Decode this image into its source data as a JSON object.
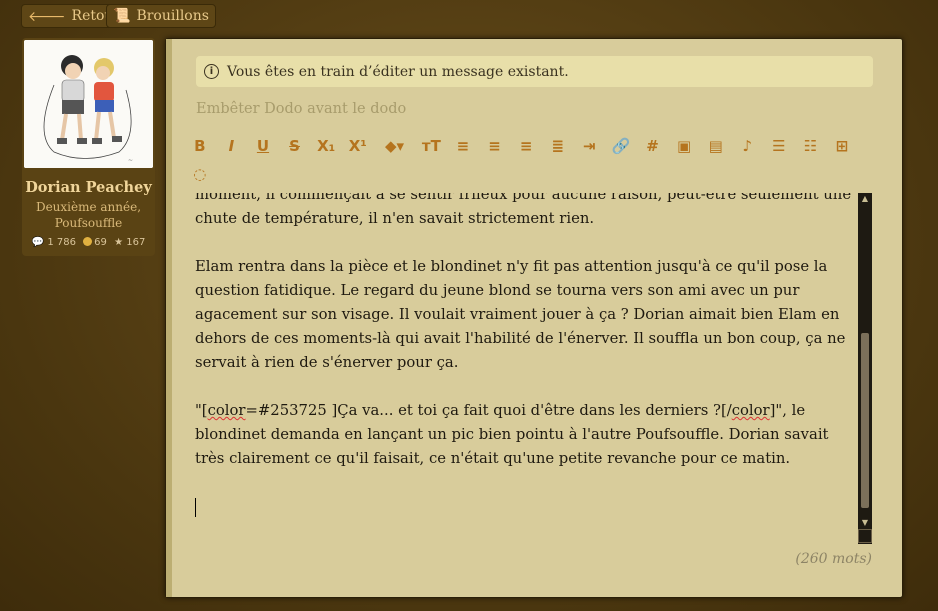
{
  "topbar": {
    "back_label": "Retour",
    "drafts_label": "Brouillons",
    "back_icon": "arrow-left-icon",
    "drafts_icon": "scroll-icon"
  },
  "profile": {
    "name": "Dorian Peachey",
    "rank": "Deuxième année, Poufsouffle",
    "stats": {
      "messages": "1 786",
      "points": "69",
      "reputation": "167"
    }
  },
  "editor": {
    "notice": "Vous êtes en train d’éditer un message existant.",
    "subject": "Embêter Dodo avant le dodo",
    "toolbar": [
      {
        "name": "bold",
        "glyph": "B"
      },
      {
        "name": "italic",
        "glyph": "I"
      },
      {
        "name": "underline",
        "glyph": "U"
      },
      {
        "name": "strike",
        "glyph": "S"
      },
      {
        "name": "subscript",
        "glyph": "X₁"
      },
      {
        "name": "superscript",
        "glyph": "X¹"
      },
      {
        "name": "color",
        "glyph": "◆▾"
      },
      {
        "name": "font-size",
        "glyph": "ᴛT"
      },
      {
        "name": "align-left",
        "glyph": "≡"
      },
      {
        "name": "align-center",
        "glyph": "≡"
      },
      {
        "name": "align-right",
        "glyph": "≡"
      },
      {
        "name": "justify",
        "glyph": "≣"
      },
      {
        "name": "indent",
        "glyph": "⇥"
      },
      {
        "name": "link",
        "glyph": "🔗"
      },
      {
        "name": "hashtag",
        "glyph": "#"
      },
      {
        "name": "image",
        "glyph": "▣"
      },
      {
        "name": "video",
        "glyph": "▤"
      },
      {
        "name": "music",
        "glyph": "♪"
      },
      {
        "name": "bullet-list",
        "glyph": "☰"
      },
      {
        "name": "numbered-list",
        "glyph": "☷"
      },
      {
        "name": "table",
        "glyph": "⊞"
      },
      {
        "name": "hide",
        "glyph": "◌"
      },
      {
        "name": "clear-format",
        "glyph": "⁄"
      },
      {
        "name": "quote",
        "glyph": "❞"
      },
      {
        "name": "mention",
        "glyph": "@"
      },
      {
        "name": "code",
        "glyph": "▥"
      },
      {
        "name": "emoji",
        "glyph": "☺"
      }
    ],
    "paragraphs": [
      "moment, il commençait à se sentir frileux pour aucune raison, peut-être seulement une chute de température, il n'en savait strictement rien.",
      "Elam rentra dans la pièce et le blondinet n'y fit pas attention jusqu'à ce qu'il pose la question fatidique. Le regard du jeune blond se tourna vers son ami avec un pur agacement sur son visage. Il voulait vraiment jouer à ça ? Dorian aimait bien Elam en dehors de ces moments-là qui avait l'habilité de l'énerver. Il souffla un bon coup, ça ne servait à rien de s'énerver pour ça.",
      "\"[color=#253725 ]Ça va... et toi ça fait quoi d'être dans les derniers ?[/color]\", le blondinet demanda en lançant un pic bien pointu à l'autre Poufsouffle. Dorian savait très clairement ce qu'il faisait, ce n'était qu'une petite revanche pour ce matin."
    ],
    "word_count": "(260 mots)"
  },
  "colors": {
    "page_bg": "#4e3a14",
    "panel_bg": "#d8cc9b",
    "notice_bg": "#e8dfa9",
    "toolbar_icon": "#b5741e",
    "accent": "#e8b96a"
  }
}
